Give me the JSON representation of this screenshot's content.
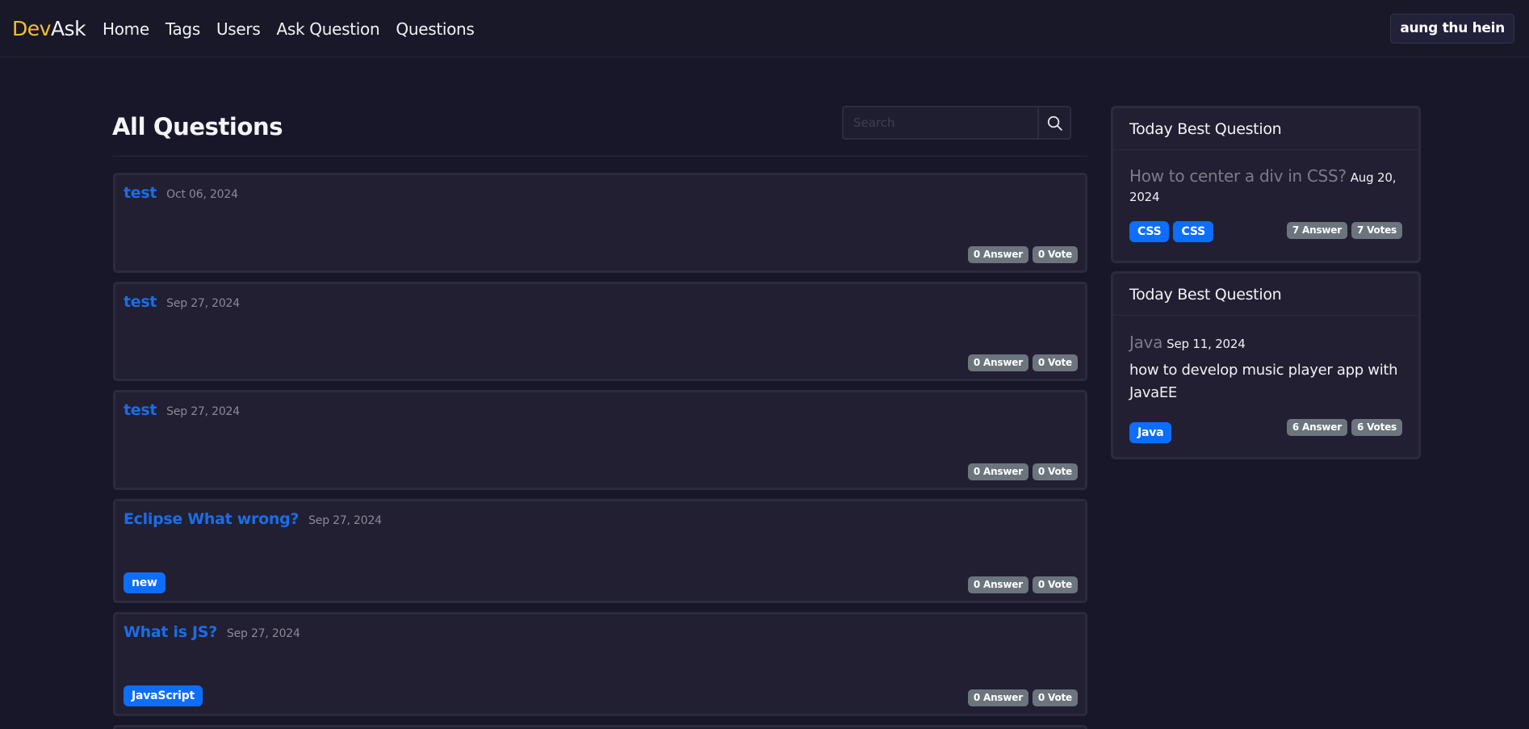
{
  "nav": {
    "brand_dev": "Dev",
    "brand_ask": "Ask",
    "links": [
      "Home",
      "Tags",
      "Users",
      "Ask Question",
      "Questions"
    ],
    "user": "aung thu hein"
  },
  "main": {
    "title": "All Questions",
    "search_placeholder": "Search"
  },
  "questions": [
    {
      "title": "test",
      "date": "Oct 06, 2024",
      "tag": "",
      "answers": "0 Answer",
      "votes": "0 Vote"
    },
    {
      "title": "test",
      "date": "Sep 27, 2024",
      "tag": "",
      "answers": "0 Answer",
      "votes": "0 Vote"
    },
    {
      "title": "test",
      "date": "Sep 27, 2024",
      "tag": "",
      "answers": "0 Answer",
      "votes": "0 Vote"
    },
    {
      "title": "Eclipse What wrong?",
      "date": "Sep 27, 2024",
      "tag": "new",
      "answers": "0 Answer",
      "votes": "0 Vote"
    },
    {
      "title": "What is JS?",
      "date": "Sep 27, 2024",
      "tag": "JavaScript",
      "answers": "0 Answer",
      "votes": "0 Vote"
    }
  ],
  "sidebar": [
    {
      "header": "Today Best Question",
      "title": "How to center a div in CSS?",
      "date": "Aug 20, 2024",
      "tags": [
        "CSS",
        "CSS"
      ],
      "answers": "7 Answer",
      "votes": "7 Votes"
    },
    {
      "header": "Today Best Question",
      "title": "Java",
      "date": "Sep 11, 2024",
      "text": "how to develop music player app with JavaEE",
      "tags": [
        "Java"
      ],
      "answers": "6 Answer",
      "votes": "6 Votes"
    }
  ],
  "icons": {
    "search": "search-icon"
  },
  "colors": {
    "accent": "#f4c029",
    "link": "#1b6dea",
    "primary": "#0d6efd",
    "secondary": "#6c757d",
    "background": "#18172a",
    "card": "#211f31"
  }
}
